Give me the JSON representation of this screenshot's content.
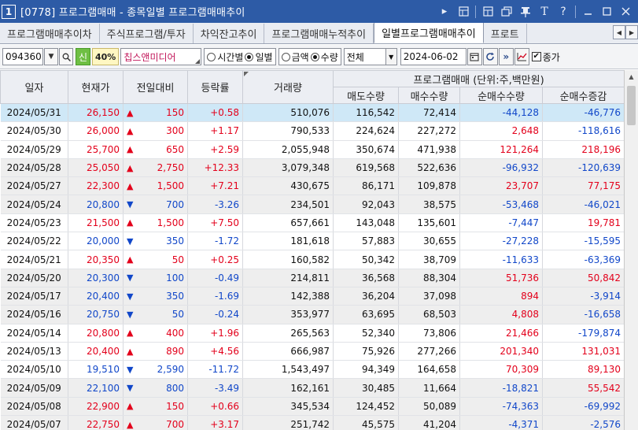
{
  "window": {
    "number": "1",
    "title": "[0778] 프로그램매매 - 종목일별 프로그램매매추이",
    "icons": [
      "play-icon",
      "grid-icon",
      "layout-icon",
      "copy-icon",
      "pin-icon",
      "font-icon",
      "help-icon",
      "minimize-icon",
      "maximize-icon",
      "close-icon"
    ]
  },
  "tabs": [
    {
      "label": "프로그램매매추이차",
      "active": false
    },
    {
      "label": "주식프로그램/투자",
      "active": false
    },
    {
      "label": "차익잔고추이",
      "active": false
    },
    {
      "label": "프로그램매매누적추이",
      "active": false
    },
    {
      "label": "일별프로그램매매추이",
      "active": true
    },
    {
      "label": "프로트",
      "active": false
    }
  ],
  "toolbar": {
    "stock_code": "094360",
    "credit_badge": "신",
    "margin_badge": "40%",
    "stock_name": "칩스앤미디어",
    "time_radio": "시간별",
    "daily_radio": "일별",
    "amount_radio": "금액",
    "quantity_radio": "수량",
    "market_select": "전체",
    "date": "2024-06-02",
    "checkbox_label": "종가"
  },
  "table": {
    "headers": {
      "date": "일자",
      "price": "현재가",
      "change": "전일대비",
      "rate": "등락률",
      "volume": "거래량",
      "program_group": "프로그램매매 (단위:주,백만원)",
      "sell_qty": "매도수량",
      "buy_qty": "매수수량",
      "net_qty": "순매수수량",
      "net_change": "순매수증감"
    },
    "rows": [
      {
        "date": "2024/05/31",
        "price": "26,150",
        "dir": "up",
        "arrow": "▲",
        "change": "150",
        "rate": "+0.58",
        "volume": "510,076",
        "sell": "116,542",
        "buy": "72,414",
        "net": "-44,128",
        "netchg": "-46,776",
        "shade": "sel"
      },
      {
        "date": "2024/05/30",
        "price": "26,000",
        "dir": "up",
        "arrow": "▲",
        "change": "300",
        "rate": "+1.17",
        "volume": "790,533",
        "sell": "224,624",
        "buy": "227,272",
        "net": "2,648",
        "netchg": "-118,616",
        "shade": "white"
      },
      {
        "date": "2024/05/29",
        "price": "25,700",
        "dir": "up",
        "arrow": "▲",
        "change": "650",
        "rate": "+2.59",
        "volume": "2,055,948",
        "sell": "350,674",
        "buy": "471,938",
        "net": "121,264",
        "netchg": "218,196",
        "shade": "white"
      },
      {
        "date": "2024/05/28",
        "price": "25,050",
        "dir": "up",
        "arrow": "▲",
        "change": "2,750",
        "rate": "+12.33",
        "volume": "3,079,348",
        "sell": "619,568",
        "buy": "522,636",
        "net": "-96,932",
        "netchg": "-120,639",
        "shade": "gray"
      },
      {
        "date": "2024/05/27",
        "price": "22,300",
        "dir": "up",
        "arrow": "▲",
        "change": "1,500",
        "rate": "+7.21",
        "volume": "430,675",
        "sell": "86,171",
        "buy": "109,878",
        "net": "23,707",
        "netchg": "77,175",
        "shade": "gray"
      },
      {
        "date": "2024/05/24",
        "price": "20,800",
        "dir": "dn",
        "arrow": "▼",
        "change": "700",
        "rate": "-3.26",
        "volume": "234,501",
        "sell": "92,043",
        "buy": "38,575",
        "net": "-53,468",
        "netchg": "-46,021",
        "shade": "gray"
      },
      {
        "date": "2024/05/23",
        "price": "21,500",
        "dir": "up",
        "arrow": "▲",
        "change": "1,500",
        "rate": "+7.50",
        "volume": "657,661",
        "sell": "143,048",
        "buy": "135,601",
        "net": "-7,447",
        "netchg": "19,781",
        "shade": "white"
      },
      {
        "date": "2024/05/22",
        "price": "20,000",
        "dir": "dn",
        "arrow": "▼",
        "change": "350",
        "rate": "-1.72",
        "volume": "181,618",
        "sell": "57,883",
        "buy": "30,655",
        "net": "-27,228",
        "netchg": "-15,595",
        "shade": "white"
      },
      {
        "date": "2024/05/21",
        "price": "20,350",
        "dir": "up",
        "arrow": "▲",
        "change": "50",
        "rate": "+0.25",
        "volume": "160,582",
        "sell": "50,342",
        "buy": "38,709",
        "net": "-11,633",
        "netchg": "-63,369",
        "shade": "white"
      },
      {
        "date": "2024/05/20",
        "price": "20,300",
        "dir": "dn",
        "arrow": "▼",
        "change": "100",
        "rate": "-0.49",
        "volume": "214,811",
        "sell": "36,568",
        "buy": "88,304",
        "net": "51,736",
        "netchg": "50,842",
        "shade": "gray"
      },
      {
        "date": "2024/05/17",
        "price": "20,400",
        "dir": "dn",
        "arrow": "▼",
        "change": "350",
        "rate": "-1.69",
        "volume": "142,388",
        "sell": "36,204",
        "buy": "37,098",
        "net": "894",
        "netchg": "-3,914",
        "shade": "gray"
      },
      {
        "date": "2024/05/16",
        "price": "20,750",
        "dir": "dn",
        "arrow": "▼",
        "change": "50",
        "rate": "-0.24",
        "volume": "353,977",
        "sell": "63,695",
        "buy": "68,503",
        "net": "4,808",
        "netchg": "-16,658",
        "shade": "gray"
      },
      {
        "date": "2024/05/14",
        "price": "20,800",
        "dir": "up",
        "arrow": "▲",
        "change": "400",
        "rate": "+1.96",
        "volume": "265,563",
        "sell": "52,340",
        "buy": "73,806",
        "net": "21,466",
        "netchg": "-179,874",
        "shade": "white"
      },
      {
        "date": "2024/05/13",
        "price": "20,400",
        "dir": "up",
        "arrow": "▲",
        "change": "890",
        "rate": "+4.56",
        "volume": "666,987",
        "sell": "75,926",
        "buy": "277,266",
        "net": "201,340",
        "netchg": "131,031",
        "shade": "white"
      },
      {
        "date": "2024/05/10",
        "price": "19,510",
        "dir": "dn",
        "arrow": "▼",
        "change": "2,590",
        "rate": "-11.72",
        "volume": "1,543,497",
        "sell": "94,349",
        "buy": "164,658",
        "net": "70,309",
        "netchg": "89,130",
        "shade": "white"
      },
      {
        "date": "2024/05/09",
        "price": "22,100",
        "dir": "dn",
        "arrow": "▼",
        "change": "800",
        "rate": "-3.49",
        "volume": "162,161",
        "sell": "30,485",
        "buy": "11,664",
        "net": "-18,821",
        "netchg": "55,542",
        "shade": "gray"
      },
      {
        "date": "2024/05/08",
        "price": "22,900",
        "dir": "up",
        "arrow": "▲",
        "change": "150",
        "rate": "+0.66",
        "volume": "345,534",
        "sell": "124,452",
        "buy": "50,089",
        "net": "-74,363",
        "netchg": "-69,992",
        "shade": "gray"
      },
      {
        "date": "2024/05/07",
        "price": "22,750",
        "dir": "up",
        "arrow": "▲",
        "change": "700",
        "rate": "+3.17",
        "volume": "251,742",
        "sell": "45,575",
        "buy": "41,204",
        "net": "-4,371",
        "netchg": "-2,576",
        "shade": "gray"
      }
    ]
  },
  "colors": {
    "titlebar": "#2d5ba6",
    "up": "#e3001b",
    "down": "#1147c9",
    "selected_row": "#cfe8f7",
    "gray_row": "#eeeeee",
    "stock_name": "#c2185b"
  }
}
